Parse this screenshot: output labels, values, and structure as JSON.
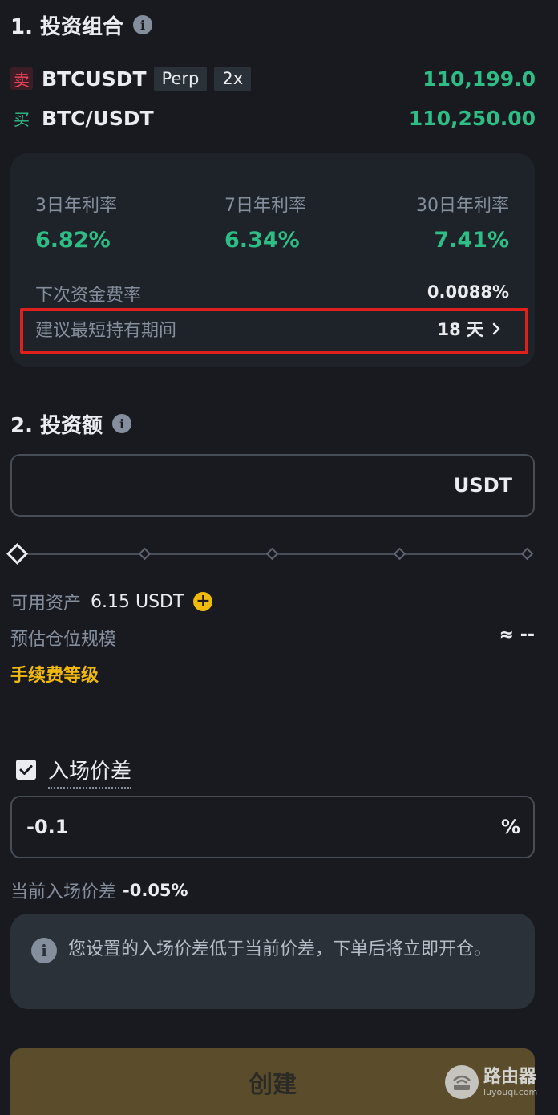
{
  "portfolio": {
    "title": "1. 投资组合",
    "legs": [
      {
        "side": "卖",
        "pair": "BTCUSDT",
        "type_chip": "Perp",
        "leverage_chip": "2x",
        "price": "110,199.0"
      },
      {
        "side": "买",
        "pair": "BTC/USDT",
        "price": "110,250.00"
      }
    ]
  },
  "rates": {
    "items": [
      {
        "label": "3日年利率",
        "value": "6.82%"
      },
      {
        "label": "7日年利率",
        "value": "6.34%"
      },
      {
        "label": "30日年利率",
        "value": "7.41%"
      }
    ],
    "next_funding_label": "下次资金费率",
    "next_funding_value": "0.0088%",
    "min_hold_label": "建议最短持有期间",
    "min_hold_value": "18 天"
  },
  "investment": {
    "title": "2. 投资额",
    "unit": "USDT",
    "slider_level": 0
  },
  "balance": {
    "available_label": "可用资产",
    "available_value": "6.15 USDT",
    "est_size_label": "预估仓位规模",
    "est_size_value": "≈ --",
    "fee_tier_link": "手续费等级"
  },
  "entry_spread": {
    "checked": true,
    "label": "入场价差",
    "value": "-0.1",
    "unit": "%",
    "current_label": "当前入场价差",
    "current_value": "-0.05%",
    "notice_text": "您设置的入场价差低于当前价差，下单后将立即开仓。"
  },
  "actions": {
    "create_label": "创建"
  },
  "watermark": {
    "title": "路由器",
    "subtitle": "luyouqi.com"
  },
  "colors": {
    "positive": "#2ebd85",
    "negative": "#f6465d",
    "accent": "#f0b90b",
    "highlight": "#e0201c"
  }
}
